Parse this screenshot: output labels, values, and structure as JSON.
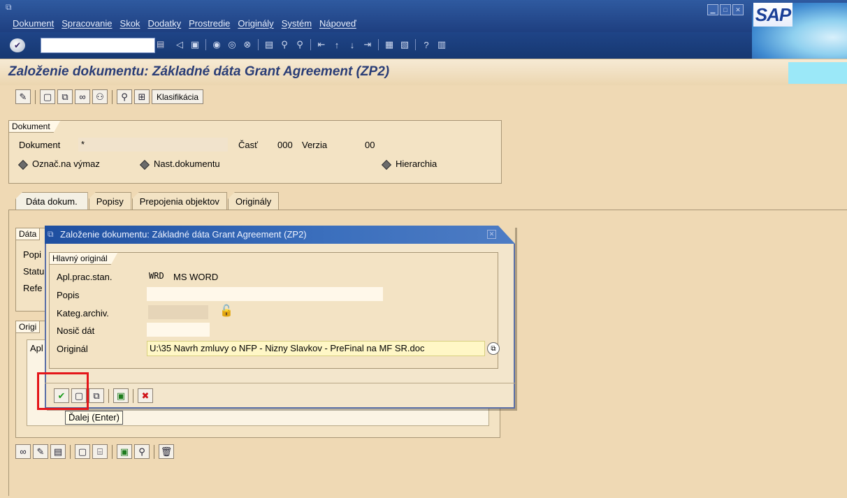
{
  "menu": {
    "items": [
      "Dokument",
      "Spracovanie",
      "Skok",
      "Dodatky",
      "Prostredie",
      "Originály",
      "Systém",
      "Nápoveď"
    ],
    "brand": "SAP"
  },
  "screen": {
    "title": "Založenie dokumentu: Základné dáta Grant Agreement (ZP2)"
  },
  "app_toolbar": {
    "klasifikacia_label": "Klasifikácia"
  },
  "dokument_group": {
    "title": "Dokument",
    "dokument_label": "Dokument",
    "dokument_value": "*",
    "cast_label": "Časť",
    "cast_value": "000",
    "verzia_label": "Verzia",
    "verzia_value": "00",
    "oznac_label": "Označ.na výmaz",
    "nast_label": "Nast.dokumentu",
    "hierarchia_label": "Hierarchia"
  },
  "tabs": [
    {
      "label": "Dáta dokum.",
      "active": true
    },
    {
      "label": "Popisy",
      "active": false
    },
    {
      "label": "Prepojenia objektov",
      "active": false
    },
    {
      "label": "Originály",
      "active": false
    }
  ],
  "background_groups": {
    "data_title": "Dáta",
    "rows": [
      "Popi",
      "Statu",
      "Refe"
    ],
    "orig_title": "Origi",
    "orig_col": "Apl"
  },
  "popup": {
    "title": "Založenie dokumentu: Základné dáta Grant Agreement (ZP2)",
    "group_title": "Hlavný originál",
    "apl_label": "Apl.prac.stan.",
    "apl_code": "WRD",
    "apl_desc": "MS WORD",
    "popis_label": "Popis",
    "popis_value": "",
    "kateg_label": "Kateg.archiv.",
    "kateg_value": "",
    "nosic_label": "Nosič dát",
    "nosic_value": "",
    "original_label": "Originál",
    "original_value": "U:\\35 Navrh zmluvy o NFP - Nizny Slavkov - PreFinal na MF SR.doc",
    "tooltip": "Ďalej  (Enter)"
  }
}
